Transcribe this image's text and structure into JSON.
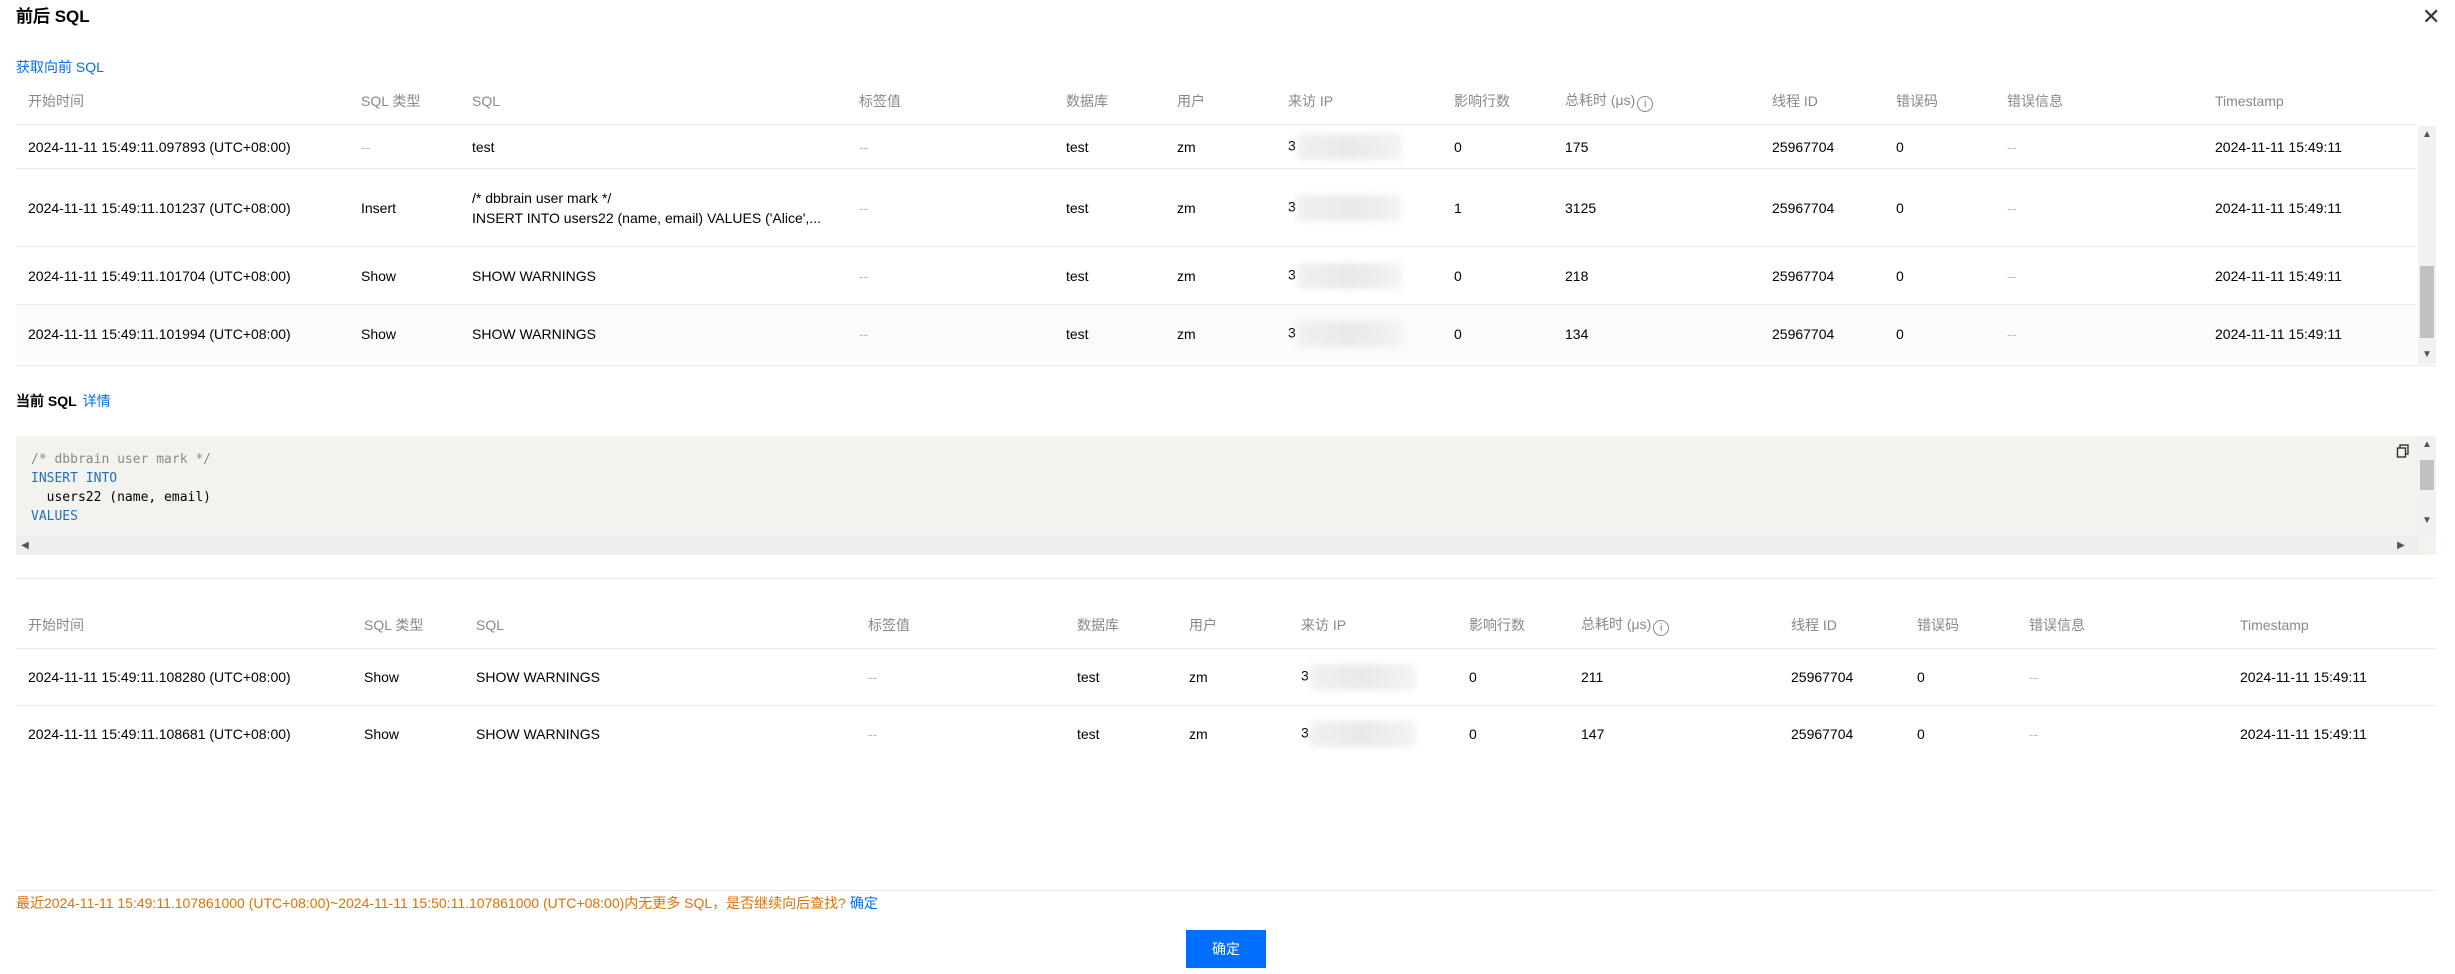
{
  "dialog": {
    "title": "前后 SQL",
    "close_icon": "close-icon",
    "prev_link": "获取向前 SQL"
  },
  "columns": [
    "开始时间",
    "SQL 类型",
    "SQL",
    "标签值",
    "数据库",
    "用户",
    "来访 IP",
    "影响行数",
    "总耗时 (μs)",
    "线程 ID",
    "错误码",
    "错误信息",
    "Timestamp"
  ],
  "info_icon": "i",
  "top_table": {
    "rows": [
      {
        "start": "2024-11-11 15:49:11.097893 (UTC+08:00)",
        "type": "--",
        "sql_lines": [
          "test"
        ],
        "tag": "--",
        "db": "test",
        "user": "zm",
        "ip": "3",
        "rows": "0",
        "cost": "175",
        "thread": "25967704",
        "errcode": "0",
        "errmsg": "--",
        "ts": "2024-11-11 15:49:11"
      },
      {
        "start": "2024-11-11 15:49:11.101237 (UTC+08:00)",
        "type": "Insert",
        "sql_lines": [
          "/* dbbrain user mark */",
          "INSERT INTO users22 (name, email) VALUES ('Alice',..."
        ],
        "tag": "--",
        "db": "test",
        "user": "zm",
        "ip": "3",
        "rows": "1",
        "cost": "3125",
        "thread": "25967704",
        "errcode": "0",
        "errmsg": "--",
        "ts": "2024-11-11 15:49:11"
      },
      {
        "start": "2024-11-11 15:49:11.101704 (UTC+08:00)",
        "type": "Show",
        "sql_lines": [
          "SHOW WARNINGS"
        ],
        "tag": "--",
        "db": "test",
        "user": "zm",
        "ip": "3",
        "rows": "0",
        "cost": "218",
        "thread": "25967704",
        "errcode": "0",
        "errmsg": "--",
        "ts": "2024-11-11 15:49:11"
      },
      {
        "start": "2024-11-11 15:49:11.101994 (UTC+08:00)",
        "type": "Show",
        "sql_lines": [
          "SHOW WARNINGS"
        ],
        "tag": "--",
        "db": "test",
        "user": "zm",
        "ip": "3",
        "rows": "0",
        "cost": "134",
        "thread": "25967704",
        "errcode": "0",
        "errmsg": "--",
        "ts": "2024-11-11 15:49:11"
      }
    ]
  },
  "current_sql": {
    "label": "当前 SQL",
    "detail_link": "详情",
    "copy_icon": "copy-icon",
    "code_lines": [
      {
        "text": "/* dbbrain user mark */",
        "kind": "comment"
      },
      {
        "text": "INSERT INTO",
        "kind": "kw"
      },
      {
        "text": "  users22 (name, email)",
        "kind": "plain"
      },
      {
        "text": "VALUES",
        "kind": "kw"
      }
    ]
  },
  "bottom_table": {
    "rows": [
      {
        "start": "2024-11-11 15:49:11.108280 (UTC+08:00)",
        "type": "Show",
        "sql": "SHOW WARNINGS",
        "tag": "--",
        "db": "test",
        "user": "zm",
        "ip": "3",
        "rows": "0",
        "cost": "211",
        "thread": "25967704",
        "errcode": "0",
        "errmsg": "--",
        "ts": "2024-11-11 15:49:11"
      },
      {
        "start": "2024-11-11 15:49:11.108681 (UTC+08:00)",
        "type": "Show",
        "sql": "SHOW WARNINGS",
        "tag": "--",
        "db": "test",
        "user": "zm",
        "ip": "3",
        "rows": "0",
        "cost": "147",
        "thread": "25967704",
        "errcode": "0",
        "errmsg": "--",
        "ts": "2024-11-11 15:49:11"
      }
    ]
  },
  "footer": {
    "notice": "最近2024-11-11 15:49:11.107861000 (UTC+08:00)~2024-11-11 15:50:11.107861000 (UTC+08:00)内无更多 SQL，是否继续向后查找?",
    "notice_link": "确定",
    "ok_button": "确定"
  },
  "colors": {
    "accent": "#006eff",
    "warning": "#e07000"
  }
}
